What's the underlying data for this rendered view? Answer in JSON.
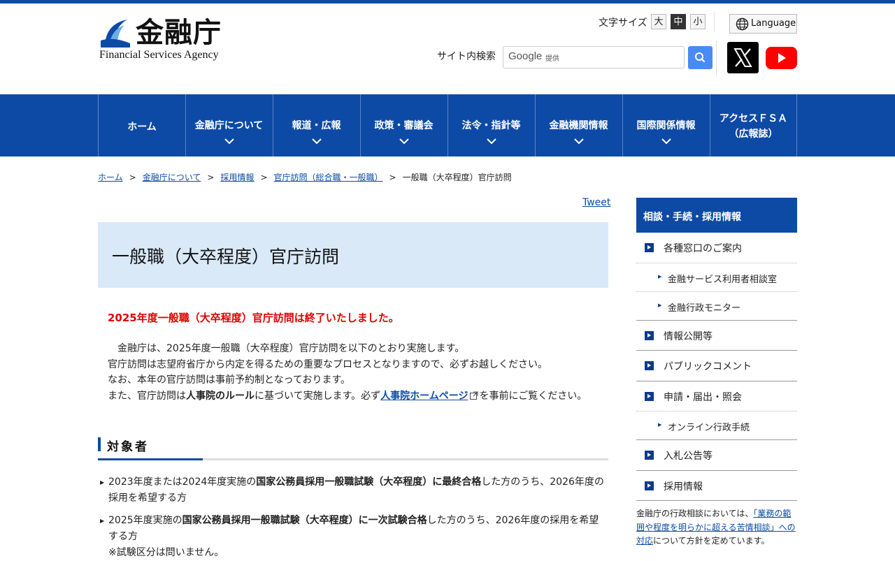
{
  "header": {
    "logo_jp": "金融庁",
    "logo_en": "Financial Services Agency",
    "font_size_label": "文字サイズ",
    "font_sizes": [
      "大",
      "中",
      "小"
    ],
    "font_size_selected": "中",
    "language_label": "Language",
    "search_label": "サイト内検索",
    "search_google": "Google",
    "search_provided": "提供",
    "sns": [
      "x-icon",
      "youtube-icon"
    ]
  },
  "nav": [
    {
      "label": "ホーム",
      "has_dropdown": false
    },
    {
      "label": "金融庁について",
      "has_dropdown": true
    },
    {
      "label": "報道・広報",
      "has_dropdown": true
    },
    {
      "label": "政策・審議会",
      "has_dropdown": true
    },
    {
      "label": "法令・指針等",
      "has_dropdown": true
    },
    {
      "label": "金融機関情報",
      "has_dropdown": true
    },
    {
      "label": "国際関係情報",
      "has_dropdown": true
    },
    {
      "label": "アクセスＦＳＡ",
      "label2": "（広報誌）",
      "has_dropdown": false
    }
  ],
  "breadcrumb": [
    "ホーム",
    "金融庁について",
    "採用情報",
    "官庁訪問（総合職・一般職）",
    "一般職（大卒程度）官庁訪問"
  ],
  "tweet": "Tweet",
  "page_title": "一般職（大卒程度）官庁訪問",
  "notice": "2025年度一般職（大卒程度）官庁訪問は終了いたしました。",
  "intro": {
    "line1": "　金融庁は、2025年度一般職（大卒程度）官庁訪問を以下のとおり実施します。",
    "line2": "官庁訪問は志望府省庁から内定を得るための重要なプロセスとなりますので、必ずお越しください。",
    "line3": "なお、本年の官庁訪問は事前予約制となっております。",
    "line4_a": "また、官庁訪問は",
    "line4_b": "人事院のルール",
    "line4_c": "に基づいて実施します。必ず",
    "line4_link": "人事院ホームページ",
    "line4_d": "を事前にご覧ください。"
  },
  "section": {
    "heading": "対象者",
    "items": [
      {
        "a": "2023年度または2024年度実施の",
        "b": "国家公務員採用一般職試験（大卒程度）に最終合格",
        "c": "した方のうち、2026年度の採用を希望する方"
      },
      {
        "a": "2025年度実施の",
        "b": "国家公務員採用一般職試験（大卒程度）に一次試験合格",
        "c": "した方のうち、2026年度の採用を希望する方",
        "note": "※試験区分は問いません。"
      }
    ]
  },
  "sidebar": {
    "heading": "相談・手続・採用情報",
    "items": [
      {
        "label": "各種窓口のご案内",
        "sub": [
          "金融サービス利用者相談室",
          "金融行政モニター"
        ]
      },
      {
        "label": "情報公開等",
        "sub": []
      },
      {
        "label": "パブリックコメント",
        "sub": []
      },
      {
        "label": "申請・届出・照会",
        "sub": [
          "オンライン行政手続"
        ]
      },
      {
        "label": "入札公告等",
        "sub": []
      },
      {
        "label": "採用情報",
        "sub": []
      }
    ],
    "note_a": "金融庁の行政相談においては、",
    "note_link": "「業務の範囲や程度を明らかに超える苦情相談」への対応",
    "note_b": "について方針を定めています。"
  },
  "colors": {
    "brand": "#0d4aa5",
    "notice": "#dd0000",
    "title_bg": "#d9e9f8"
  }
}
